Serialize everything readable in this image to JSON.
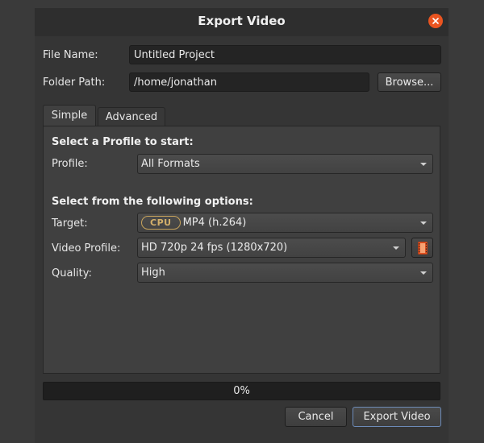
{
  "dialog": {
    "title": "Export Video",
    "close_icon": "close-icon"
  },
  "file": {
    "name_label": "File Name:",
    "name_value": "Untitled Project",
    "folder_label": "Folder Path:",
    "folder_value": "/home/jonathan",
    "browse_label": "Browse..."
  },
  "tabs": [
    {
      "label": "Simple",
      "active": true
    },
    {
      "label": "Advanced",
      "active": false
    }
  ],
  "simple": {
    "profile_heading": "Select a Profile to start:",
    "profile_label": "Profile:",
    "profile_value": "All Formats",
    "options_heading": "Select from the following options:",
    "target_label": "Target:",
    "target_badge": "CPU",
    "target_value": "MP4 (h.264)",
    "video_profile_label": "Video Profile:",
    "video_profile_value": "HD 720p 24 fps (1280x720)",
    "video_profile_icon": "film-icon",
    "quality_label": "Quality:",
    "quality_value": "High"
  },
  "progress": {
    "value": 0,
    "text": "0%"
  },
  "footer": {
    "cancel_label": "Cancel",
    "export_label": "Export Video"
  },
  "colors": {
    "accent": "#e95420",
    "badge": "#c7a35b",
    "background": "#353535"
  }
}
